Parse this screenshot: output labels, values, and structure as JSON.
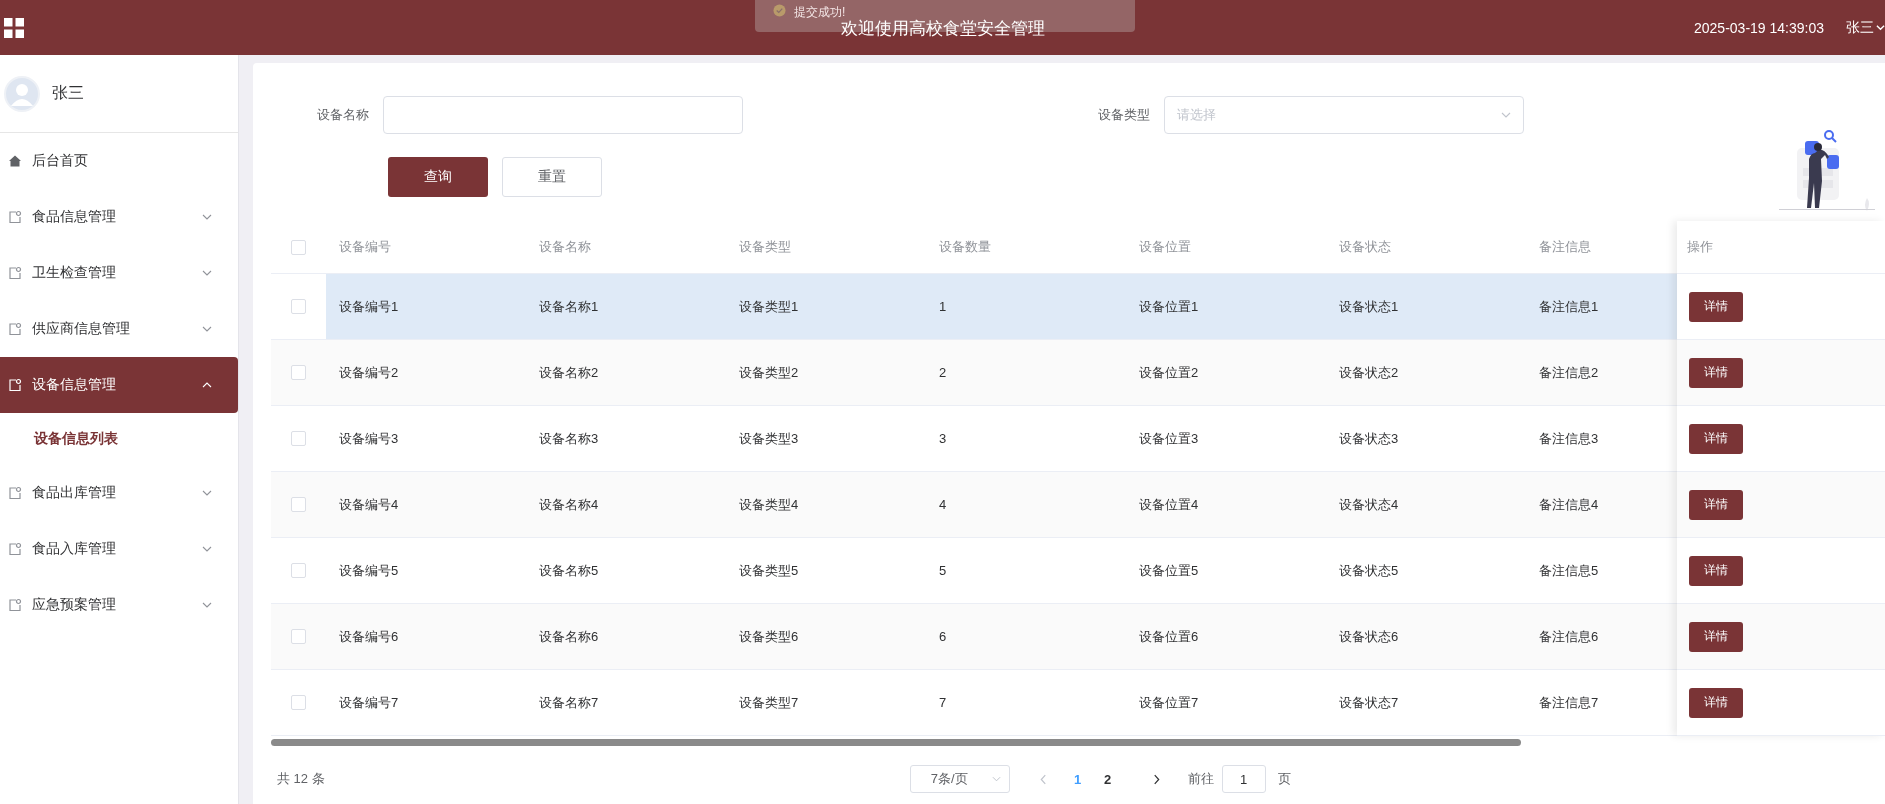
{
  "header": {
    "title": "欢迎使用高校食堂安全管理",
    "datetime": "2025-03-19 14:39:03",
    "user": "张三"
  },
  "toast": {
    "text": "提交成功!"
  },
  "sidebar": {
    "user": "张三",
    "items": [
      {
        "label": "后台首页",
        "kind": "home",
        "selected": false
      },
      {
        "label": "食品信息管理",
        "kind": "group",
        "expanded": false,
        "selected": false
      },
      {
        "label": "卫生检查管理",
        "kind": "group",
        "expanded": false,
        "selected": false
      },
      {
        "label": "供应商信息管理",
        "kind": "group",
        "expanded": false,
        "selected": false
      },
      {
        "label": "设备信息管理",
        "kind": "group",
        "expanded": true,
        "selected": true,
        "children": [
          {
            "label": "设备信息列表",
            "selected": true
          }
        ]
      },
      {
        "label": "食品出库管理",
        "kind": "group",
        "expanded": false,
        "selected": false
      },
      {
        "label": "食品入库管理",
        "kind": "group",
        "expanded": false,
        "selected": false
      },
      {
        "label": "应急预案管理",
        "kind": "group",
        "expanded": false,
        "selected": false
      }
    ]
  },
  "filters": [
    {
      "label": "设备名称",
      "kind": "input"
    },
    {
      "label": "设备类型",
      "kind": "select",
      "placeholder": "请选择"
    }
  ],
  "buttons": [
    {
      "label": "查询",
      "kind": "primary"
    },
    {
      "label": "重置",
      "kind": "default"
    }
  ],
  "table": {
    "all_checked": false,
    "columns": [
      "设备编号",
      "设备名称",
      "设备类型",
      "设备数量",
      "设备位置",
      "设备状态",
      "备注信息",
      "操作"
    ],
    "rows": [
      {
        "checked": false,
        "highlighted": true,
        "cells": [
          "设备编号1",
          "设备名称1",
          "设备类型1",
          "1",
          "设备位置1",
          "设备状态1",
          "备注信息1"
        ],
        "action": "详情"
      },
      {
        "checked": false,
        "highlighted": false,
        "cells": [
          "设备编号2",
          "设备名称2",
          "设备类型2",
          "2",
          "设备位置2",
          "设备状态2",
          "备注信息2"
        ],
        "action": "详情"
      },
      {
        "checked": false,
        "highlighted": false,
        "cells": [
          "设备编号3",
          "设备名称3",
          "设备类型3",
          "3",
          "设备位置3",
          "设备状态3",
          "备注信息3"
        ],
        "action": "详情"
      },
      {
        "checked": false,
        "highlighted": false,
        "cells": [
          "设备编号4",
          "设备名称4",
          "设备类型4",
          "4",
          "设备位置4",
          "设备状态4",
          "备注信息4"
        ],
        "action": "详情"
      },
      {
        "checked": false,
        "highlighted": false,
        "cells": [
          "设备编号5",
          "设备名称5",
          "设备类型5",
          "5",
          "设备位置5",
          "设备状态5",
          "备注信息5"
        ],
        "action": "详情"
      },
      {
        "checked": false,
        "highlighted": false,
        "cells": [
          "设备编号6",
          "设备名称6",
          "设备类型6",
          "6",
          "设备位置6",
          "设备状态6",
          "备注信息6"
        ],
        "action": "详情"
      },
      {
        "checked": false,
        "highlighted": false,
        "cells": [
          "设备编号7",
          "设备名称7",
          "设备类型7",
          "7",
          "设备位置7",
          "设备状态7",
          "备注信息7"
        ],
        "action": "详情"
      }
    ]
  },
  "pagination": {
    "total": "共 12 条",
    "page_size": "7条/页",
    "pages": [
      {
        "label": "1",
        "selected": true
      },
      {
        "label": "2",
        "selected": false
      }
    ],
    "goto": "前往",
    "goto_value": "1",
    "page_unit": "页"
  }
}
